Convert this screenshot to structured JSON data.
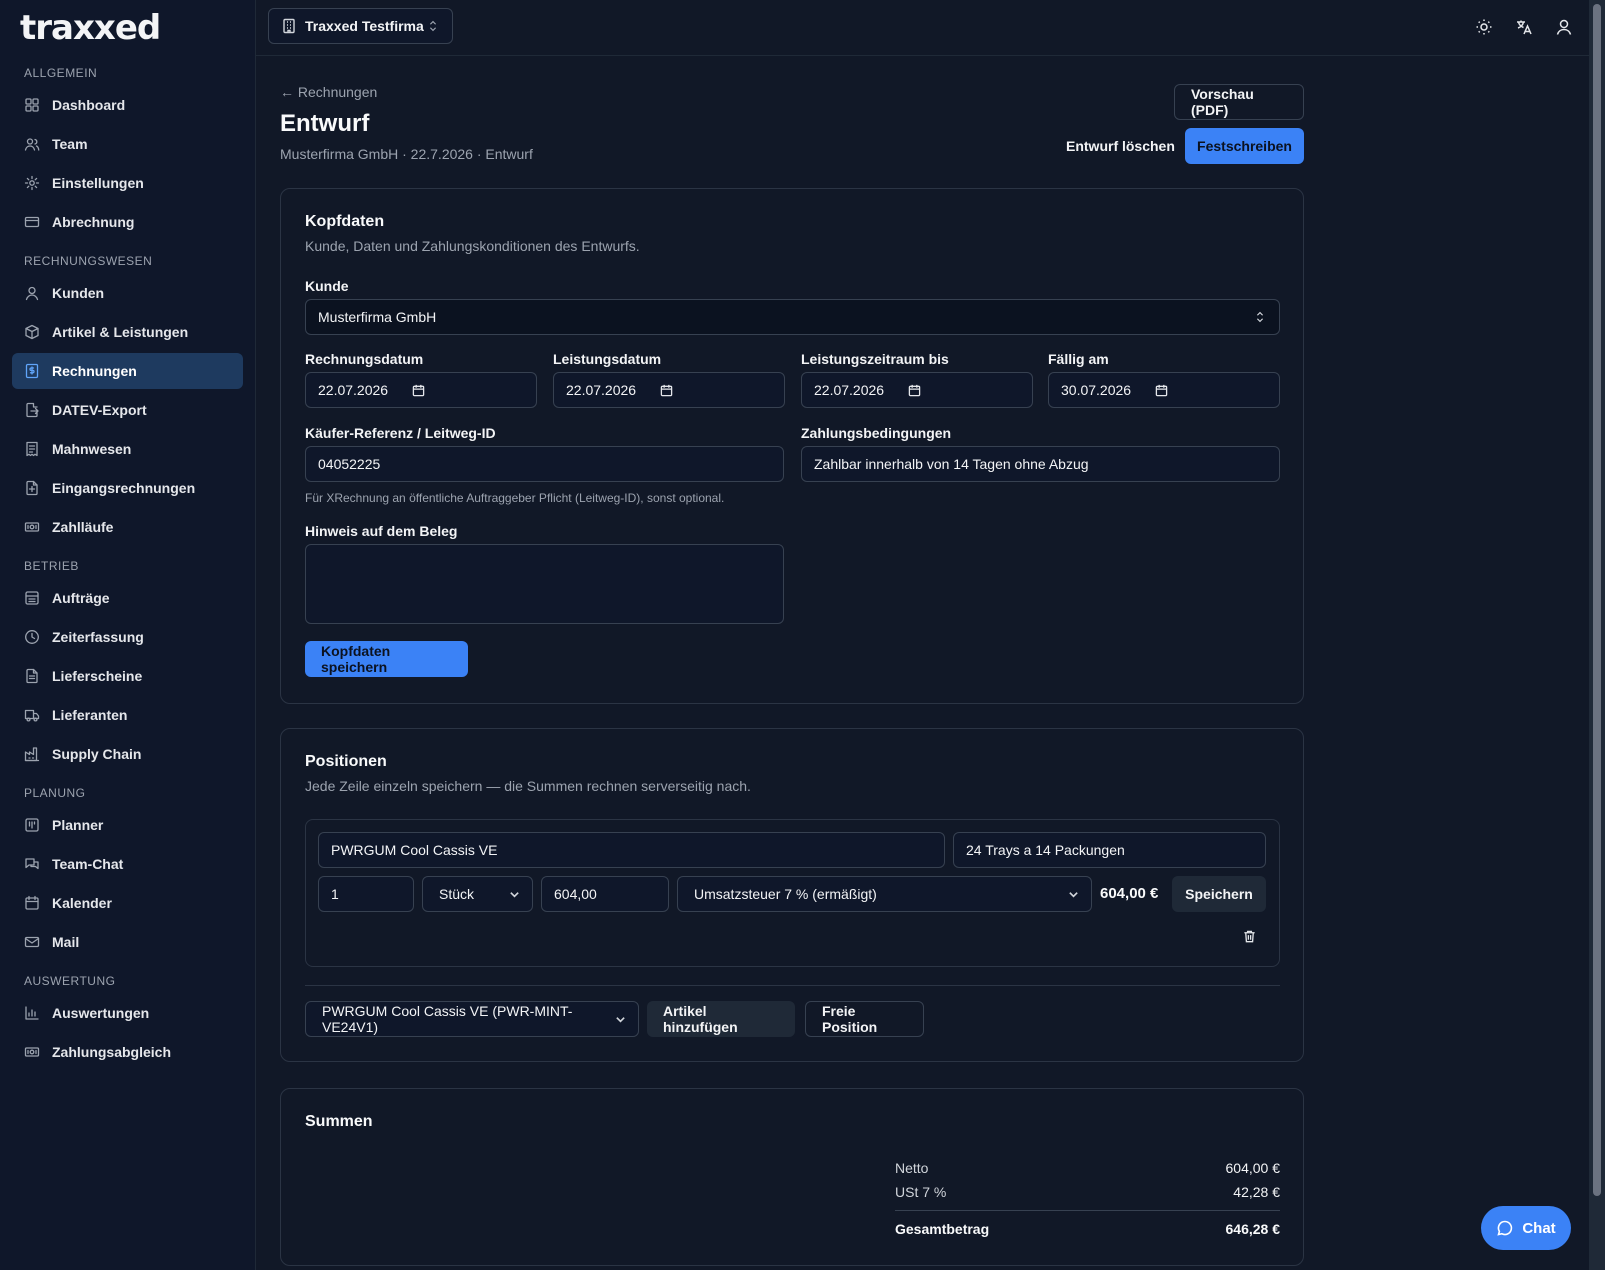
{
  "app": {
    "logo": "traxxed",
    "tenant": "Traxxed Testfirma"
  },
  "sidebar": {
    "sections": [
      {
        "title": "ALLGEMEIN",
        "items": [
          {
            "label": "Dashboard",
            "icon": "dashboard-icon"
          },
          {
            "label": "Team",
            "icon": "users-icon"
          },
          {
            "label": "Einstellungen",
            "icon": "gear-icon"
          },
          {
            "label": "Abrechnung",
            "icon": "credit-card-icon"
          }
        ]
      },
      {
        "title": "RECHNUNGSWESEN",
        "items": [
          {
            "label": "Kunden",
            "icon": "user-icon"
          },
          {
            "label": "Artikel & Leistungen",
            "icon": "package-icon"
          },
          {
            "label": "Rechnungen",
            "icon": "invoice-icon",
            "active": true
          },
          {
            "label": "DATEV-Export",
            "icon": "export-icon"
          },
          {
            "label": "Mahnwesen",
            "icon": "receipt-icon"
          },
          {
            "label": "Eingangsrechnungen",
            "icon": "inbox-icon"
          },
          {
            "label": "Zahlläufe",
            "icon": "banknote-icon"
          }
        ]
      },
      {
        "title": "BETRIEB",
        "items": [
          {
            "label": "Aufträge",
            "icon": "orders-icon"
          },
          {
            "label": "Zeiterfassung",
            "icon": "clock-icon"
          },
          {
            "label": "Lieferscheine",
            "icon": "document-icon"
          },
          {
            "label": "Lieferanten",
            "icon": "truck-icon"
          },
          {
            "label": "Supply Chain",
            "icon": "factory-icon"
          }
        ]
      },
      {
        "title": "PLANUNG",
        "items": [
          {
            "label": "Planner",
            "icon": "kanban-icon"
          },
          {
            "label": "Team-Chat",
            "icon": "chat-icon"
          },
          {
            "label": "Kalender",
            "icon": "calendar-icon"
          },
          {
            "label": "Mail",
            "icon": "mail-icon"
          }
        ]
      },
      {
        "title": "AUSWERTUNG",
        "items": [
          {
            "label": "Auswertungen",
            "icon": "bar-chart-icon"
          },
          {
            "label": "Zahlungsabgleich",
            "icon": "banknote-icon"
          }
        ]
      }
    ]
  },
  "page": {
    "back": "← Rechnungen",
    "title": "Entwurf",
    "subtitle": "Musterfirma GmbH · 22.7.2026 · Entwurf",
    "preview_btn": "Vorschau (PDF)",
    "delete_btn": "Entwurf löschen",
    "finalize_btn": "Festschreiben"
  },
  "header_card": {
    "title": "Kopfdaten",
    "desc": "Kunde, Daten und Zahlungskonditionen des Entwurfs.",
    "customer_label": "Kunde",
    "customer_value": "Musterfirma GmbH",
    "invoice_date_label": "Rechnungsdatum",
    "invoice_date": "22.07.2026",
    "service_date_label": "Leistungsdatum",
    "service_date": "22.07.2026",
    "service_until_label": "Leistungszeitraum bis",
    "service_until": "22.07.2026",
    "due_label": "Fällig am",
    "due": "30.07.2026",
    "buyer_ref_label": "Käufer-Referenz / Leitweg-ID",
    "buyer_ref": "04052225",
    "buyer_ref_hint": "Für XRechnung an öffentliche Auftraggeber Pflicht (Leitweg-ID), sonst optional.",
    "payment_terms_label": "Zahlungsbedingungen",
    "payment_terms": "Zahlbar innerhalb von 14 Tagen ohne Abzug",
    "note_label": "Hinweis auf dem Beleg",
    "note": "",
    "save_btn": "Kopfdaten speichern"
  },
  "positions_card": {
    "title": "Positionen",
    "desc": "Jede Zeile einzeln speichern — die Summen rechnen serverseitig nach.",
    "line": {
      "name": "PWRGUM Cool Cassis VE",
      "description": "24 Trays a 14 Packungen",
      "qty": "1",
      "unit": "Stück",
      "price": "604,00",
      "tax": "Umsatzsteuer 7 % (ermäßigt)",
      "total": "604,00 €",
      "save_btn": "Speichern"
    },
    "article_select": "PWRGUM Cool Cassis VE (PWR-MINT-VE24V1)",
    "add_article_btn": "Artikel hinzufügen",
    "free_position_btn": "Freie Position"
  },
  "sums_card": {
    "title": "Summen",
    "net_label": "Netto",
    "net": "604,00 €",
    "vat_label": "USt 7 %",
    "vat": "42,28 €",
    "total_label": "Gesamtbetrag",
    "total": "646,28 €"
  },
  "chat": {
    "label": "Chat"
  },
  "colors": {
    "accent": "#3b82f6",
    "bg": "#111827",
    "sidebar": "#0f172a",
    "active": "#1e3a5f"
  }
}
